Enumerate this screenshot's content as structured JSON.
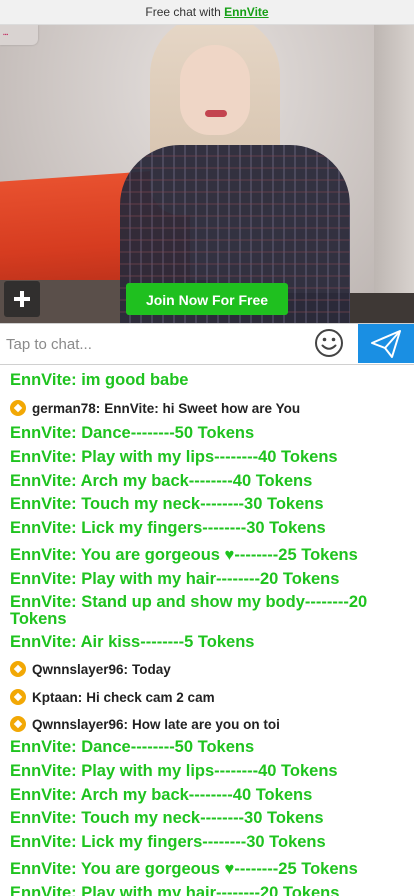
{
  "topbar": {
    "prefix": "Free chat with",
    "brand": "EnnVite"
  },
  "video": {
    "join_label": "Join Now For Free"
  },
  "chat_input": {
    "placeholder": "Tap to chat..."
  },
  "icons": {
    "add": "plus-icon",
    "emoji": "smiley-icon",
    "send": "paper-plane-icon"
  },
  "colors": {
    "accent_green": "#1fc31f",
    "send_blue": "#1a8fe3",
    "coin": "#f2a805"
  },
  "messages": [
    {
      "type": "model",
      "text": "EnnVite: im good babe"
    },
    {
      "type": "user",
      "name": "german78:",
      "text": "EnnVite: hi Sweet how are You"
    },
    {
      "type": "model",
      "text": "EnnVite: Dance--------50 Tokens"
    },
    {
      "type": "model",
      "text": "EnnVite: Play with my lips--------40 Tokens"
    },
    {
      "type": "model",
      "text": "EnnVite: Arch my back--------40 Tokens"
    },
    {
      "type": "model",
      "text": "EnnVite: Touch my neck--------30 Tokens"
    },
    {
      "type": "model",
      "text": "EnnVite: Lick my fingers--------30 Tokens"
    },
    {
      "type": "model",
      "text": "EnnVite: You are gorgeous ♥--------25 Tokens"
    },
    {
      "type": "model",
      "text": "EnnVite: Play with my hair--------20 Tokens"
    },
    {
      "type": "model",
      "text": "EnnVite: Stand up and show my body--------20 Tokens"
    },
    {
      "type": "model",
      "text": "EnnVite: Air kiss--------5 Tokens"
    },
    {
      "type": "user",
      "name": "Qwnnslayer96:",
      "text": "Today"
    },
    {
      "type": "user",
      "name": "Kptaan:",
      "text": "Hi check cam 2 cam"
    },
    {
      "type": "user",
      "name": "Qwnnslayer96:",
      "text": "How late are you on toi"
    },
    {
      "type": "model",
      "text": "EnnVite: Dance--------50 Tokens"
    },
    {
      "type": "model",
      "text": "EnnVite: Play with my lips--------40 Tokens"
    },
    {
      "type": "model",
      "text": "EnnVite: Arch my back--------40 Tokens"
    },
    {
      "type": "model",
      "text": "EnnVite: Touch my neck--------30 Tokens"
    },
    {
      "type": "model",
      "text": "EnnVite: Lick my fingers--------30 Tokens"
    },
    {
      "type": "model",
      "text": "EnnVite: You are gorgeous ♥--------25 Tokens"
    },
    {
      "type": "model",
      "text": "EnnVite: Play with my hair--------20 Tokens"
    }
  ]
}
